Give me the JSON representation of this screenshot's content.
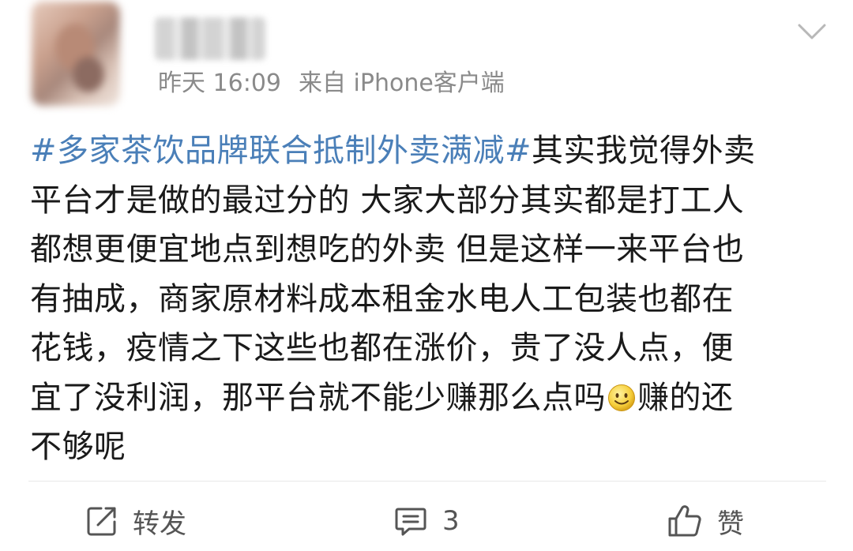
{
  "post": {
    "meta": {
      "time": "昨天 16:09",
      "source": "来自 iPhone客户端"
    },
    "content": {
      "topic": "#多家茶饮品牌联合抵制外卖满减#",
      "line1_rest": "其实我觉得外卖",
      "line2": "平台才是做的最过分的 大家大部分其实都是打工人",
      "line3": "都想更便宜地点到想吃的外卖 但是这样一来平台也",
      "line4": "有抽成，商家原材料成本租金水电人工包装也都在",
      "line5": "花钱，疫情之下这些也都在涨价，贵了没人点，便",
      "line6_a": "宜了没利润，那平台就不能少赚那么点吗",
      "line6_b": "赚的还",
      "line7": "不够呢",
      "emoji_name": "smile-emoji"
    },
    "actions": {
      "repost_label": "转发",
      "comment_count": "3",
      "like_label": "赞"
    }
  },
  "colors": {
    "topic": "#4a7fb8",
    "meta": "#8a8a8a",
    "text": "#1a1a1a",
    "icon": "#555555"
  },
  "icons": [
    "chevron-down-icon",
    "repost-icon",
    "comment-icon",
    "like-icon",
    "smile-emoji"
  ]
}
